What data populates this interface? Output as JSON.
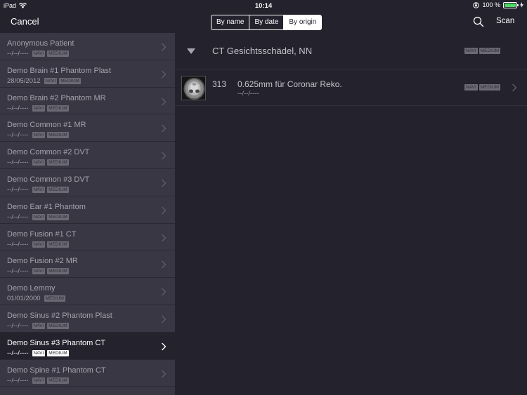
{
  "status_bar": {
    "device": "iPad",
    "time": "10:14",
    "battery": "100 %",
    "battery_level": 1.0
  },
  "navbar": {
    "cancel_label": "Cancel",
    "segments": [
      "By name",
      "By date",
      "By origin"
    ],
    "selected_segment": "By origin",
    "scan_label": "Scan"
  },
  "patients": [
    {
      "name": "Anonymous Patient",
      "date": "--/--/----",
      "badges": [
        "NAVI",
        "MEDIUM"
      ]
    },
    {
      "name": "Demo Brain #1 Phantom Plast",
      "date": "28/05/2012",
      "badges": [
        "NAVI",
        "MEDIUM"
      ]
    },
    {
      "name": "Demo Brain #2 Phantom MR",
      "date": "--/--/----",
      "badges": [
        "NAVI",
        "MEDIUM"
      ]
    },
    {
      "name": "Demo Common #1 MR",
      "date": "--/--/----",
      "badges": [
        "NAVI",
        "MEDIUM"
      ]
    },
    {
      "name": "Demo Common #2 DVT",
      "date": "--/--/----",
      "badges": [
        "NAVI",
        "MEDIUM"
      ]
    },
    {
      "name": "Demo Common #3 DVT",
      "date": "--/--/----",
      "badges": [
        "NAVI",
        "MEDIUM"
      ]
    },
    {
      "name": "Demo Ear #1 Phantom",
      "date": "--/--/----",
      "badges": [
        "NAVI",
        "MEDIUM"
      ]
    },
    {
      "name": "Demo Fusion #1 CT",
      "date": "--/--/----",
      "badges": [
        "NAVI",
        "MEDIUM"
      ]
    },
    {
      "name": "Demo Fusion #2 MR",
      "date": "--/--/----",
      "badges": [
        "NAVI",
        "MEDIUM"
      ]
    },
    {
      "name": "Demo Lemmy",
      "date": "01/01/2000",
      "badges": [
        "MEDIUM"
      ]
    },
    {
      "name": "Demo Sinus #2 Phantom Plast",
      "date": "--/--/----",
      "badges": [
        "NAVI",
        "MEDIUM"
      ]
    },
    {
      "name": "Demo Sinus #3 Phantom CT",
      "date": "--/--/----",
      "badges": [
        "NAVI",
        "MEDIUM"
      ],
      "selected": true
    },
    {
      "name": "Demo Spine #1 Phantom CT",
      "date": "--/--/----",
      "badges": [
        "NAVI",
        "MEDIUM"
      ]
    }
  ],
  "detail": {
    "group_title": "CT Gesichtsschädel, NN",
    "group_badges": [
      "NAVI",
      "MEDIUM"
    ],
    "series": {
      "number": "313",
      "title": "0.625mm für Coronar Reko.",
      "date": "--/--/----",
      "badges": [
        "NAVI",
        "MEDIUM"
      ]
    }
  },
  "colors": {
    "background": "#23222d",
    "list_background": "#383743",
    "battery": "#4cd964"
  }
}
